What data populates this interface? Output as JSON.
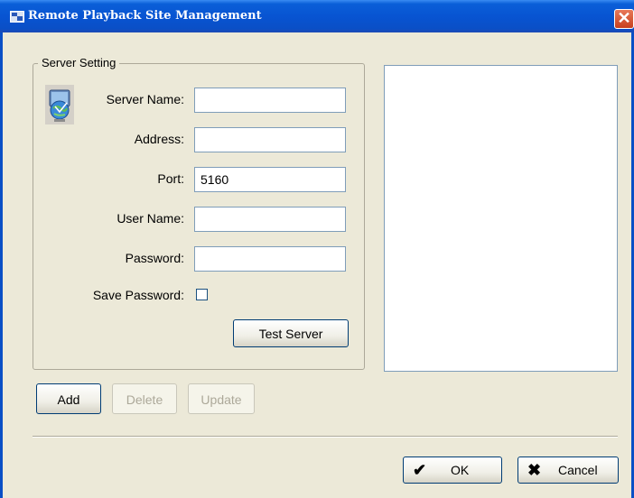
{
  "window": {
    "title": "Remote Playback Site Management",
    "close_glyph": "✕",
    "title_icon": "site-management-icon"
  },
  "server_setting": {
    "legend": "Server Setting",
    "icon": "server-globe-icon",
    "fields": {
      "server_name": {
        "label": "Server Name:",
        "value": ""
      },
      "address": {
        "label": "Address:",
        "value": ""
      },
      "port": {
        "label": "Port:",
        "value": "5160"
      },
      "user_name": {
        "label": "User Name:",
        "value": ""
      },
      "password": {
        "label": "Password:",
        "value": ""
      }
    },
    "save_password": {
      "label": "Save Password:",
      "checked": false
    },
    "test_server_label": "Test Server"
  },
  "actions": {
    "add_label": "Add",
    "delete_label": "Delete",
    "update_label": "Update"
  },
  "dialog_buttons": {
    "ok_label": "OK",
    "ok_glyph": "✔",
    "cancel_label": "Cancel",
    "cancel_glyph": "✖"
  },
  "colors": {
    "titlebar": "#0854d2",
    "dialog_bg": "#ece9d8",
    "button_border": "#003c74",
    "close_red": "#d0502c"
  }
}
